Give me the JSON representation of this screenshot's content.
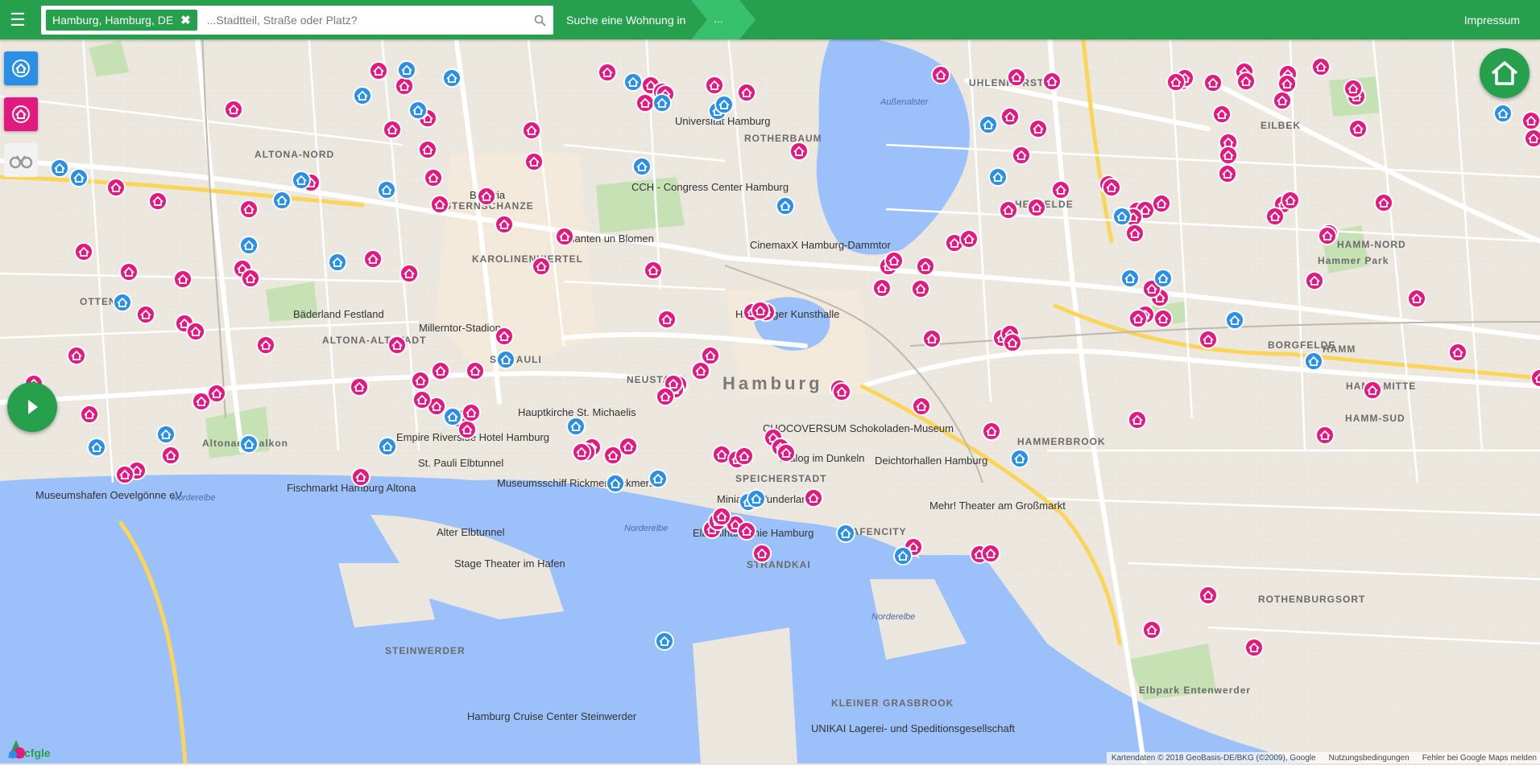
{
  "search": {
    "chip_label": "Hamburg, Hamburg, DE",
    "chip_remove": "✖",
    "placeholder": "...Stadtteil, Straße oder Platz?",
    "cta_label": "Suche eine Wohnung in",
    "cta_value": "..."
  },
  "topbar": {
    "menu_icon": "☰",
    "impressum": "Impressum"
  },
  "colors": {
    "bar_green": "#26a04d",
    "marker_pink": "#e2197e",
    "marker_blue": "#2b8fe6",
    "water": "#9cc0f9"
  },
  "map": {
    "city_label": "Hamburg",
    "district_labels": [
      "ALTONA-NORD",
      "ALTONA-ALTSTADT",
      "OTTEN",
      "STERNSCHANZE",
      "KAROLINENVIERTEL",
      "ROTHERBAUM",
      "UHLENHORST",
      "EILBEK",
      "HAMM-NORD",
      "HAMM",
      "HAMM-MITTE",
      "HAMM-SUD",
      "BORGFELDE",
      "HAMMERBROOK",
      "NEUSTADT",
      "ST. PAULI",
      "SPEICHERSTADT",
      "HAFENCITY",
      "STRANDKAI",
      "STEINWERDER",
      "KLEINER GRASBROOK",
      "ROTHENBURGSORT",
      "HENFELDE",
      "Hammer Park",
      "Altonaer Balkon",
      "Elbpark Entenwerder"
    ],
    "poi_labels": [
      "CCH - Congress Center Hamburg",
      "Planten un Blomen",
      "CinemaxX Hamburg-Dammtor",
      "Hamburger Kunsthalle",
      "Bäderland Festland",
      "Millerntor-Stadion",
      "Hauptkirche St. Michaelis",
      "Empire Riverside Hotel Hamburg",
      "St. Pauli Elbtunnel",
      "Museumsschiff Rickmer Rickmers",
      "Fischmarkt Hamburg Altona",
      "Museumshafen Oevelgönne eV",
      "CHOCOVERSUM Schokoladen-Museum",
      "Dialog im Dunkeln",
      "Deichtorhallen Hamburg",
      "Mehr! Theater am Großmarkt",
      "Alter Elbtunnel",
      "Stage Theater im Hafen",
      "Elbphilharmonie Hamburg",
      "Miniatur Wunderland",
      "Hamburg Cruise Center Steinwerder",
      "UNIKAI Lagerei- und Speditionsgesellschaft",
      "Universität Hamburg",
      "Bavaria"
    ],
    "water_labels": [
      "Außenalster",
      "Norderelbe",
      "Norderelbe",
      "Norderelbe"
    ],
    "legend": {
      "pink_marker": "home-marker-pink",
      "blue_marker": "home-marker-blue"
    }
  },
  "attribution": {
    "data": "Kartendaten © 2018 GeoBasis-DE/BKG (©2009), Google",
    "terms": "Nutzungsbedingungen",
    "report": "Fehler bei Google Maps melden"
  },
  "logo_text": "cfgle"
}
